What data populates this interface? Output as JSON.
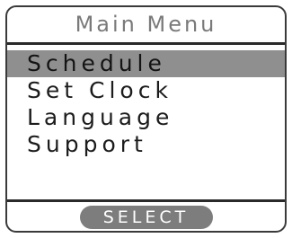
{
  "header": {
    "title": "Main Menu"
  },
  "menu": {
    "selected_index": 0,
    "items": [
      {
        "label": "Schedule"
      },
      {
        "label": "Set Clock"
      },
      {
        "label": "Language"
      },
      {
        "label": "Support"
      }
    ]
  },
  "softkey": {
    "label": "SELECT"
  },
  "colors": {
    "highlight": "#8f8f8f",
    "softkey_bg": "#7d7d7d",
    "title_text": "#7a7a7a",
    "frame": "#3a3a3a"
  }
}
